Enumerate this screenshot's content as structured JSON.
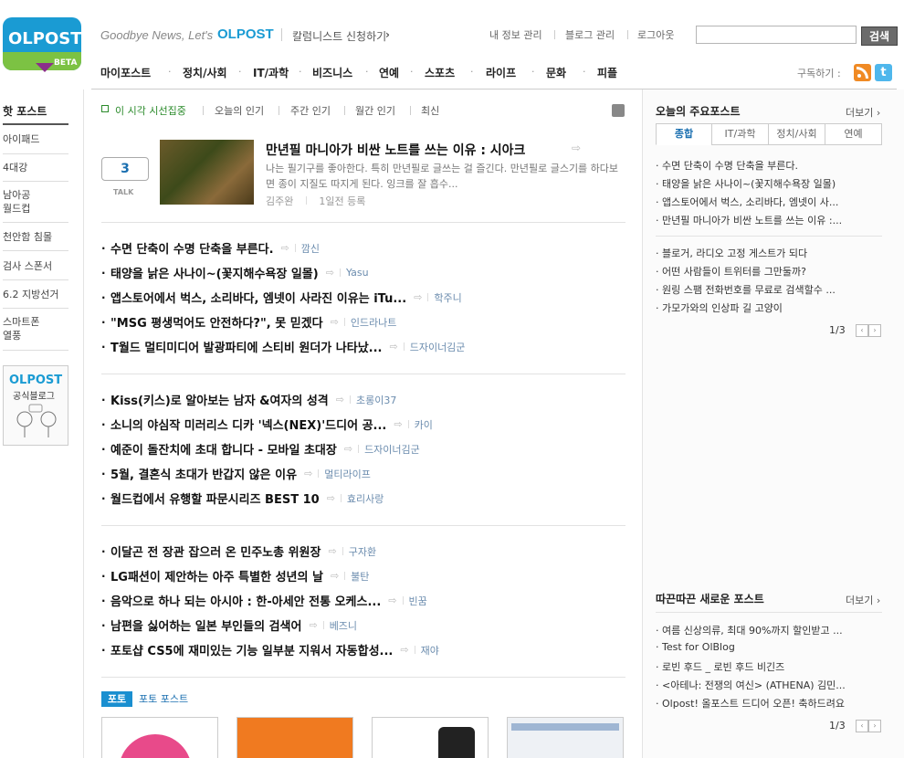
{
  "brand": {
    "logo_text": "OLPOST",
    "logo_sub": "BETA",
    "slogan": "Goodbye News,  Let's",
    "slogan_brand": "OLPOST",
    "apply_link": "칼럼니스트 신청하기",
    "apply_arrow": "›"
  },
  "util_links": [
    "내 정보 관리",
    "블로그 관리",
    "로그아웃"
  ],
  "search": {
    "placeholder": "",
    "button": "검색"
  },
  "gnb": [
    "마이포스트",
    "정치/사회",
    "IT/과학",
    "비즈니스",
    "연예",
    "스포츠",
    "라이프",
    "문화",
    "피플"
  ],
  "subscribe_label": "구독하기 :",
  "twitter_glyph": "t",
  "left": {
    "title": "핫 포스트",
    "items": [
      "아이패드",
      "4대강",
      "남아공\n월드컵",
      "천안함 침몰",
      "검사 스폰서",
      "6.2 지방선거",
      "스마트폰\n열풍"
    ],
    "banner_title": "OLPOST",
    "banner_sub": "공식블로그"
  },
  "main_tabs": [
    "이 시각 시선집중",
    "오늘의 인기",
    "주간 인기",
    "월간 인기",
    "최신"
  ],
  "feature": {
    "talk_count": "3",
    "talk_label": "TALK",
    "title": "만년필 마니아가 비싼 노트를 쓰는 이유 : 시아크",
    "desc": "나는 필기구를 좋아한다. 특히 만년필로 글쓰는 걸 즐긴다. 만년필로 글스기를 하다보면 종이 지질도 따지게 된다. 잉크를 잘 흡수...",
    "author": "김주완",
    "time": "1일전 등록"
  },
  "post_groups": [
    [
      {
        "title": "수면 단축이 수명 단축을 부른다.",
        "author": "깜신"
      },
      {
        "title": "태양을 낡은 사나이~(꽃지해수욕장 일몰)",
        "author": "Yasu"
      },
      {
        "title": "앱스토어에서 벅스, 소리바다, 엠넷이 사라진 이유는 iTu...",
        "author": "학주니"
      },
      {
        "title": "\"MSG 평생먹어도 안전하다?\", 못 믿겠다",
        "author": "인드라나트"
      },
      {
        "title": "T월드 멀티미디어 발광파티에 스티비 원더가 나타났...",
        "author": "드자이너김군"
      }
    ],
    [
      {
        "title": "Kiss(키스)로 알아보는 남자 &여자의 성격",
        "author": "초롱이37"
      },
      {
        "title": "소니의 야심작 미러리스 디카 '넥스(NEX)'드디어 공...",
        "author": "카이"
      },
      {
        "title": "예준이 돌잔치에 초대 합니다 - 모바일 초대장",
        "author": "드자이너김군"
      },
      {
        "title": "5월, 결혼식 초대가 반갑지 않은 이유",
        "author": "멀티라이프"
      },
      {
        "title": "월드컵에서 유행할 파문시리즈 BEST 10",
        "author": "효리사랑"
      }
    ],
    [
      {
        "title": "이달곤 전 장관 잡으러 온 민주노총 위원장",
        "author": "구자환"
      },
      {
        "title": "LG패션이 제안하는 아주 특별한 성년의 날",
        "author": "불탄"
      },
      {
        "title": "음악으로 하나 되는 아시아 : 한-아세안 전통 오케스...",
        "author": "빈꿈"
      },
      {
        "title": "남편을 싫어하는 일본 부인들의 검색어",
        "author": "베즈니"
      },
      {
        "title": "포토샵 CS5에 재미있는 기능 일부분 지워서 자동합성...",
        "author": "재야"
      }
    ]
  ],
  "share_glyph": "⇨",
  "photo": {
    "badge": "포토",
    "label": "포토 포스트"
  },
  "right": {
    "major": {
      "title": "오늘의 주요포스트",
      "more": "더보기 ›",
      "tabs": [
        "종합",
        "IT/과학",
        "정치/사회",
        "연예"
      ],
      "items_a": [
        "수면 단축이 수명 단축을 부른다.",
        "태양을 낡은 사나이~(꽃지해수욕장 일몰)",
        "앱스토어에서 벅스, 소리바다, 엠넷이 사...",
        "만년필 마니아가 비싼 노트를 쓰는 이유 :..."
      ],
      "items_b": [
        "블로거, 라디오 고정 게스트가 되다",
        "어떤 사람들이 트위터를 그만둘까?",
        "원링 스팸 전화번호를 무료로 검색할수 ...",
        "가모가와의 인상파 길 고양이"
      ],
      "page": "1/3"
    },
    "fresh": {
      "title": "따끈따끈 새로운 포스트",
      "more": "더보기 ›",
      "items": [
        "여름 신상의류, 최대 90%까지 할인받고 ...",
        "Test for OlBlog",
        "로빈 후드 _ 로빈 후드 비긴즈",
        "<아테나: 전쟁의 여신> (ATHENA) 김민...",
        "Olpost! 올포스트 드디어 오픈! 축하드려요"
      ],
      "page": "1/3"
    },
    "bullet": "·",
    "prev": "‹",
    "next": "›"
  }
}
